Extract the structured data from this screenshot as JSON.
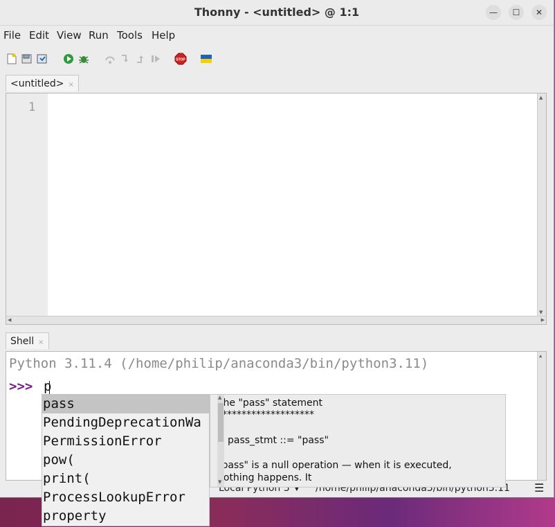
{
  "window": {
    "title": "Thonny - <untitled> @ 1:1"
  },
  "menu": [
    "File",
    "Edit",
    "View",
    "Run",
    "Tools",
    "Help"
  ],
  "toolbar_icons": [
    "new-file-icon",
    "open-file-icon",
    "save-file-icon",
    "run-icon",
    "debug-icon",
    "step-over-icon",
    "step-into-icon",
    "step-out-icon",
    "resume-icon",
    "stop-icon",
    "ukraine-flag-icon"
  ],
  "editor": {
    "tab_label": "<untitled>",
    "tab_close": "×",
    "line_number": "1"
  },
  "shell": {
    "tab_label": "Shell",
    "tab_close": "×",
    "banner": "Python 3.11.4 (/home/philip/anaconda3/bin/python3.11)",
    "prompt": ">>>",
    "input": "p"
  },
  "completions": {
    "items": [
      "pass",
      "PendingDeprecationWa",
      "PermissionError",
      "pow(",
      "print(",
      "ProcessLookupError",
      "property"
    ],
    "selected_index": 0
  },
  "doc": {
    "heading": "The \"pass\" statement",
    "underline": "********************",
    "grammar": "pass_stmt ::= \"pass\"",
    "body1": "\"pass\" is a null operation — when it is executed,",
    "body2": "nothing happens. It"
  },
  "status": {
    "interpreter": "Local Python 3",
    "path": "/home/philip/anaconda3/bin/python3.11",
    "menu_glyph": "☰"
  },
  "colors": {
    "prompt": "#7a1a8a",
    "banner": "#8a8a8a",
    "stop": "#cc2222"
  }
}
